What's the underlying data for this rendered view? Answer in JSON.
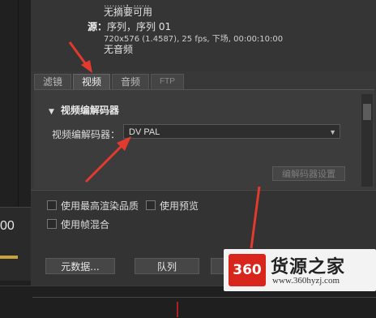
{
  "summary": {
    "line_top": "…‥…，……",
    "line_no_summary": "无摘要可用",
    "source_label": "源：",
    "source_value": "序列，序列 01",
    "video_spec": "720x576 (1.4587), 25 fps, 下场, 00:00:10:00",
    "no_audio": "无音频"
  },
  "tabs": [
    {
      "label": "滤镜",
      "active": false
    },
    {
      "label": "视频",
      "active": true
    },
    {
      "label": "音频",
      "active": false
    },
    {
      "label": "FTP",
      "active": false
    }
  ],
  "video": {
    "section_title": "视频编解码器",
    "codec_label": "视频编解码器：",
    "codec_value": "DV PAL",
    "codec_settings_button": "编解码器设置"
  },
  "options": {
    "max_render_quality": "使用最高渲染品质",
    "use_previews": "使用预览",
    "use_frame_blending": "使用帧混合"
  },
  "buttons": {
    "metadata": "元数据...",
    "queue": "队列"
  },
  "left": {
    "timecode_fragment": "00"
  },
  "watermark": {
    "logo_text": "360",
    "title": "货源之家",
    "url": "www.360hyzj.com"
  },
  "colors": {
    "arrow": "#e23a2e",
    "accent_yellow": "#c8a23a",
    "watermark_red": "#d9261c"
  }
}
